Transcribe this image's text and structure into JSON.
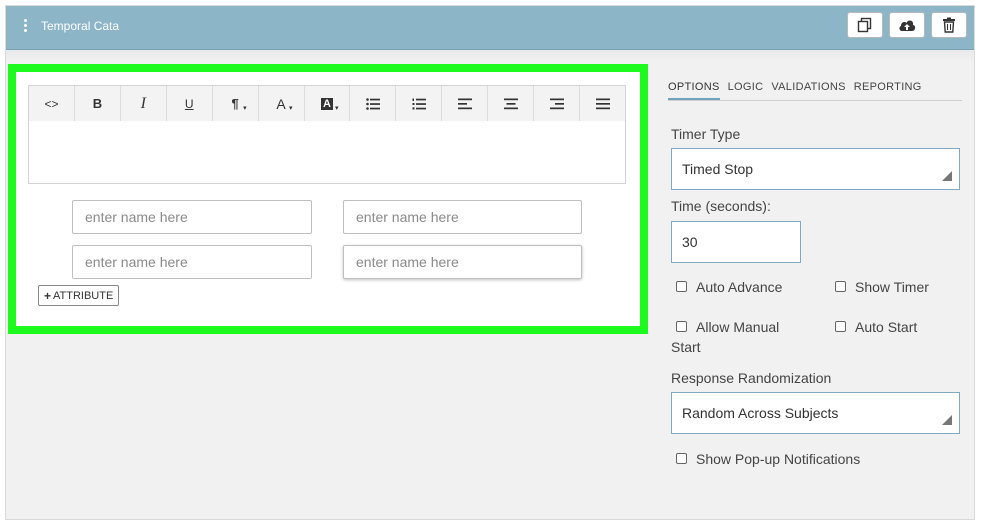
{
  "header": {
    "title": "Temporal Cata",
    "buttons": [
      {
        "icon": "duplicate-icon"
      },
      {
        "icon": "cloud-upload-icon"
      },
      {
        "icon": "trash-icon"
      }
    ]
  },
  "toolbar": {
    "code": "<>",
    "bold": "B",
    "italic": "I",
    "underline": "U",
    "paragraph": "¶",
    "font_color": "A",
    "highlight": "A",
    "bullet_list": "bullet-list-icon",
    "numbered_list": "numbered-list-icon",
    "align_left": "align-left-icon",
    "align_center": "align-center-icon",
    "align_right": "align-right-icon",
    "justify": "justify-icon"
  },
  "name_fields": [
    {
      "placeholder": "enter name here",
      "value": ""
    },
    {
      "placeholder": "enter name here",
      "value": ""
    },
    {
      "placeholder": "enter name here",
      "value": ""
    },
    {
      "placeholder": "enter name here",
      "value": ""
    }
  ],
  "attribute_button": "ATTRIBUTE",
  "panel": {
    "tabs": [
      "OPTIONS",
      "LOGIC",
      "VALIDATIONS",
      "REPORTING"
    ],
    "active_tab": "OPTIONS",
    "timer_type_label": "Timer Type",
    "timer_type_value": "Timed Stop",
    "time_label": "Time (seconds):",
    "time_value": "30",
    "checkboxes": {
      "auto_advance": "Auto Advance",
      "show_timer": "Show Timer",
      "allow_manual_start": "Allow Manual Start",
      "auto_start": "Auto Start",
      "show_popup": "Show Pop-up Notifications"
    },
    "randomization_label": "Response Randomization",
    "randomization_value": "Random Across Subjects"
  },
  "colors": {
    "header": "#8cb5c8",
    "highlight_border": "#1dfa1d",
    "input_border": "#7ea9c0"
  }
}
